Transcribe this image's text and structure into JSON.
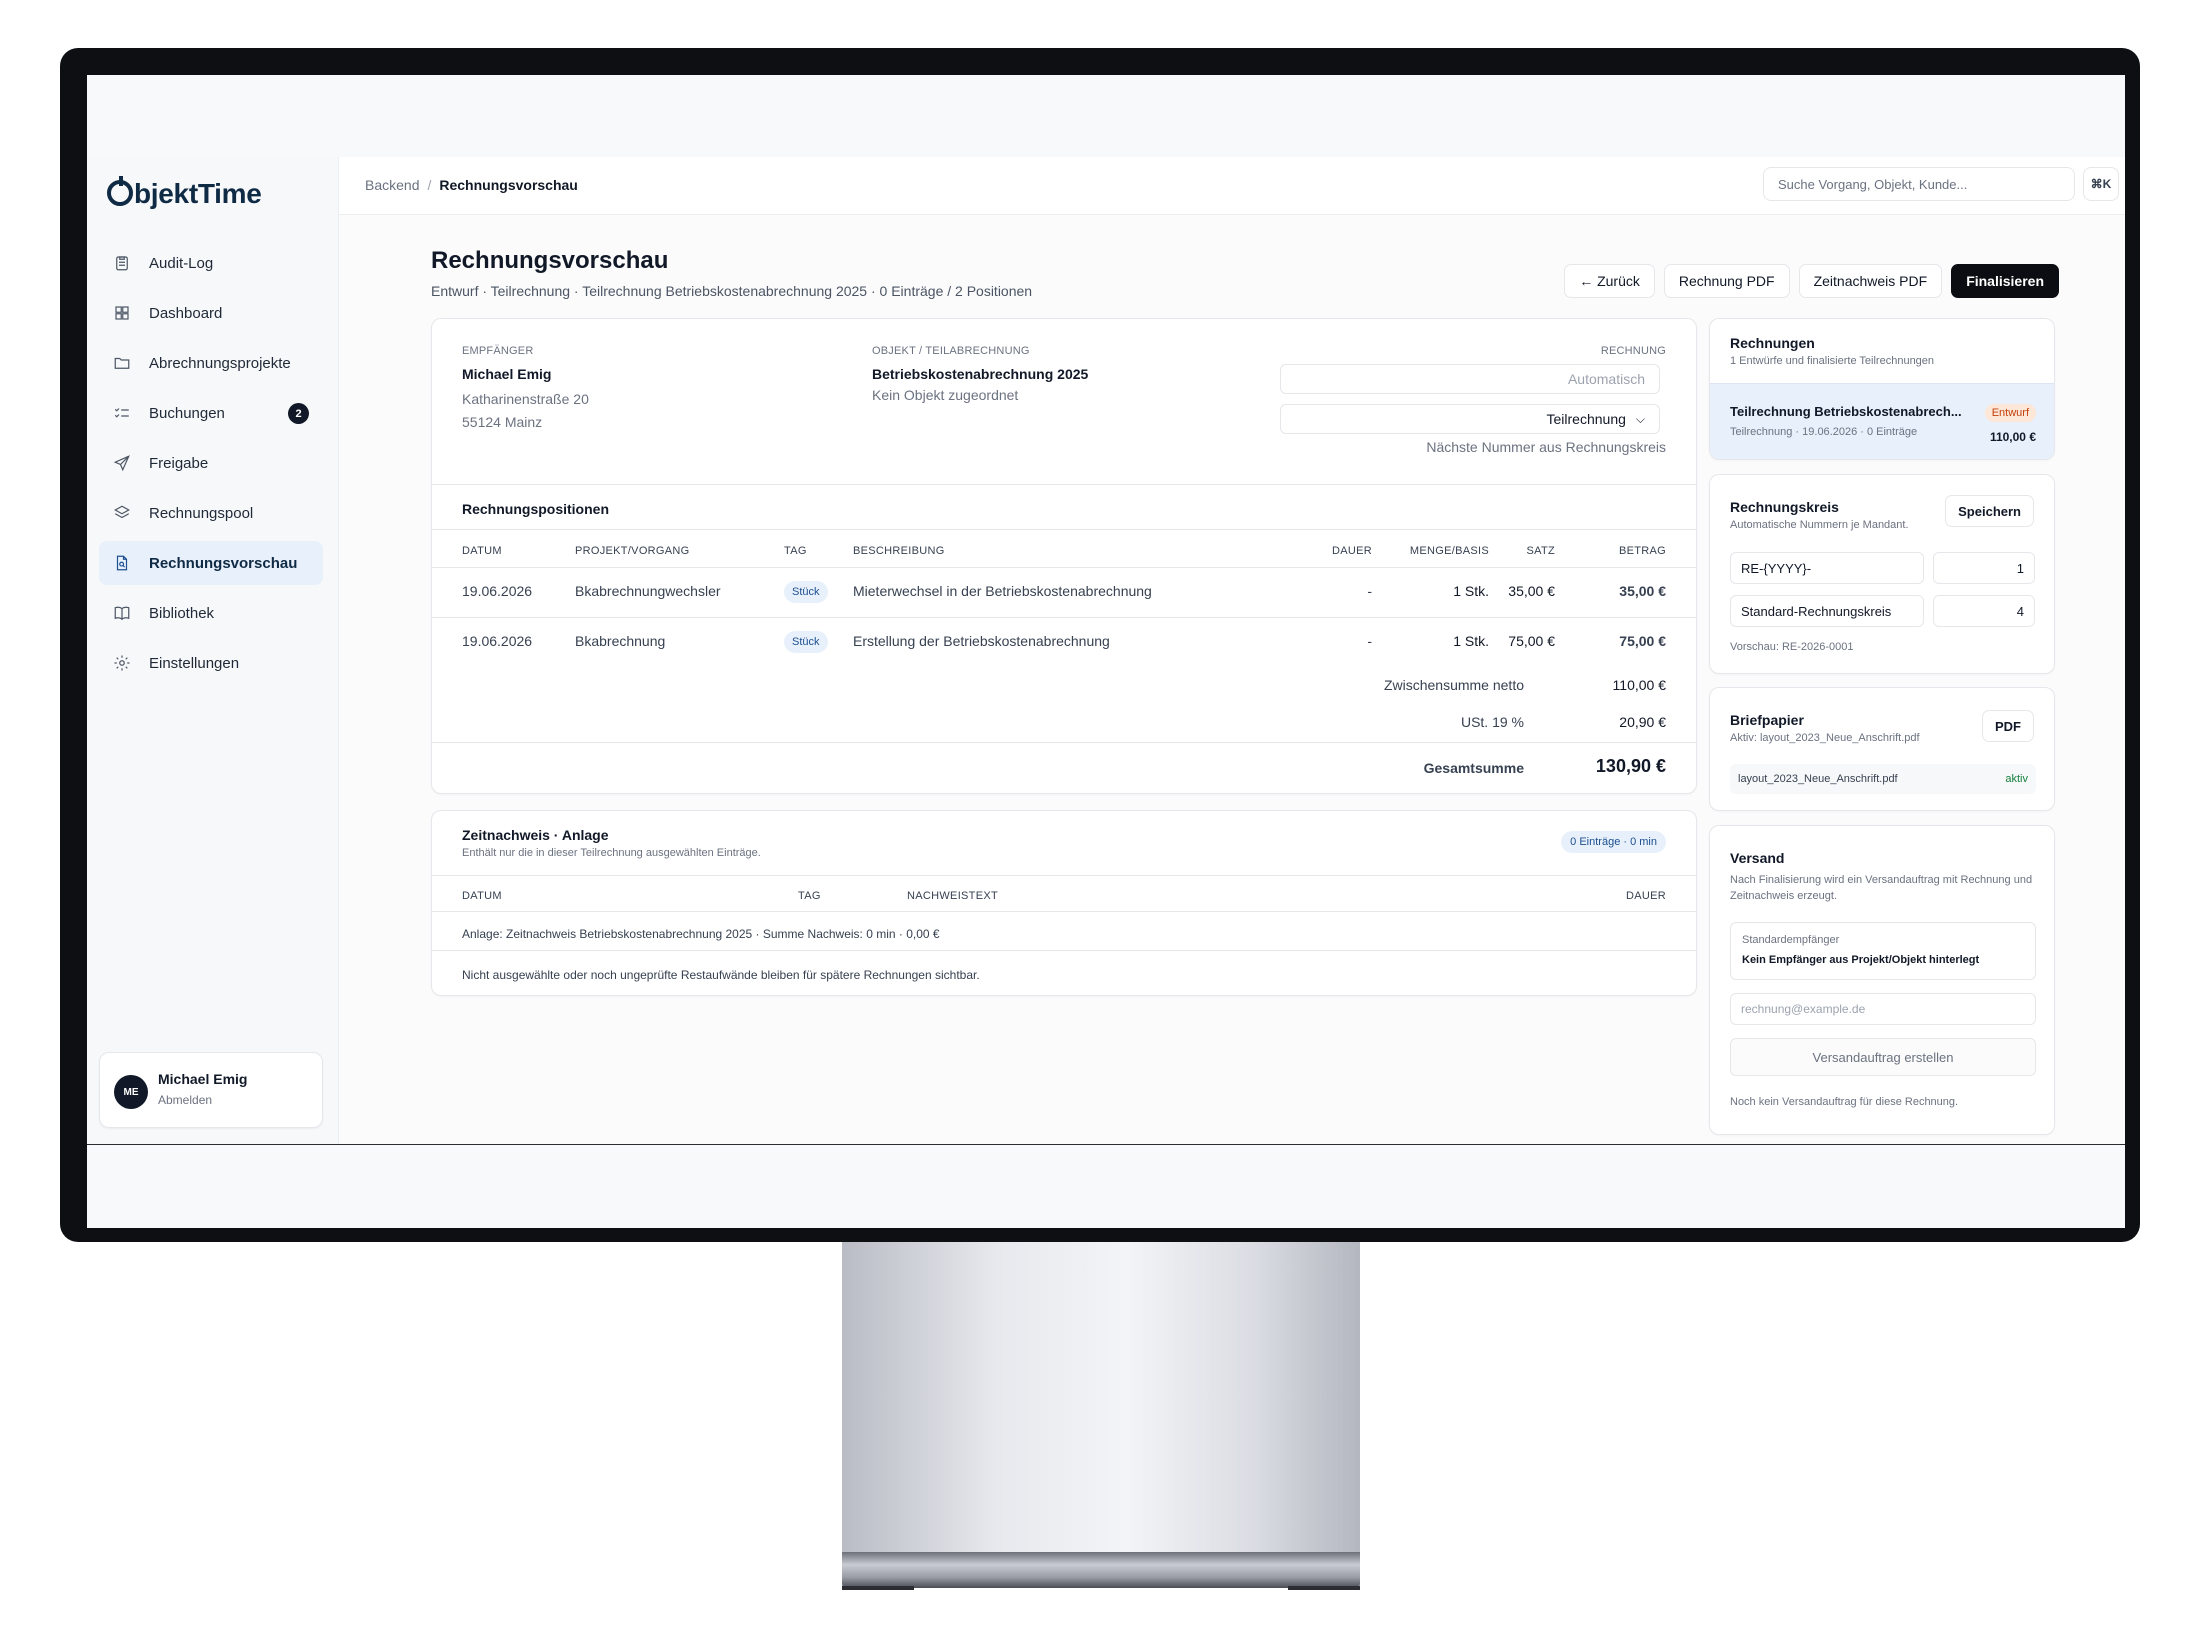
{
  "brand": {
    "name_rest": "bjektTime"
  },
  "sidebar": {
    "items": [
      {
        "label": "Audit-Log"
      },
      {
        "label": "Dashboard"
      },
      {
        "label": "Abrechnungsprojekte"
      },
      {
        "label": "Buchungen",
        "badge": "2"
      },
      {
        "label": "Freigabe"
      },
      {
        "label": "Rechnungspool"
      },
      {
        "label": "Rechnungsvorschau"
      },
      {
        "label": "Bibliothek"
      },
      {
        "label": "Einstellungen"
      }
    ],
    "user": {
      "initials": "ME",
      "name": "Michael Emig",
      "logout": "Abmelden"
    }
  },
  "topbar": {
    "breadcrumb_root": "Backend",
    "breadcrumb_sep": "/",
    "breadcrumb_current": "Rechnungsvorschau",
    "search_placeholder": "Suche Vorgang, Objekt, Kunde...",
    "shortcut": "⌘K"
  },
  "page": {
    "title": "Rechnungsvorschau",
    "subtitle": "Entwurf · Teilrechnung · Teilrechnung Betriebskostenabrechnung 2025 · 0 Einträge / 2 Positionen",
    "actions": {
      "back": "← Zurück",
      "invoice_pdf": "Rechnung PDF",
      "timesheet_pdf": "Zeitnachweis PDF",
      "finalize": "Finalisieren"
    }
  },
  "invoice": {
    "recipient_label": "EMPFÄNGER",
    "recipient_name": "Michael Emig",
    "recipient_street": "Katharinenstraße 20",
    "recipient_city": "55124 Mainz",
    "object_label": "OBJEKT / TEILABRECHNUNG",
    "object_name": "Betriebskostenabrechnung 2025",
    "object_note": "Kein Objekt zugeordnet",
    "invoice_label": "RECHNUNG",
    "number_placeholder": "Automatisch",
    "type_value": "Teilrechnung",
    "number_hint": "Nächste Nummer aus Rechnungskreis",
    "positions_title": "Rechnungspositionen",
    "columns": {
      "date": "DATUM",
      "project": "PROJEKT/VORGANG",
      "tag": "TAG",
      "description": "BESCHREIBUNG",
      "duration": "DAUER",
      "quantity": "MENGE/BASIS",
      "rate": "SATZ",
      "amount": "BETRAG"
    },
    "rows": [
      {
        "date": "19.06.2026",
        "project": "Bkabrechnungwechsler",
        "tag": "Stück",
        "description": "Mieterwechsel in der Betriebskostenabrechnung",
        "duration": "-",
        "quantity": "1 Stk.",
        "rate": "35,00 €",
        "amount": "35,00 €"
      },
      {
        "date": "19.06.2026",
        "project": "Bkabrechnung",
        "tag": "Stück",
        "description": "Erstellung der Betriebskostenabrechnung",
        "duration": "-",
        "quantity": "1 Stk.",
        "rate": "75,00 €",
        "amount": "75,00 €"
      }
    ],
    "subtotal_label": "Zwischensumme netto",
    "subtotal_value": "110,00 €",
    "vat_label": "USt. 19 %",
    "vat_value": "20,90 €",
    "total_label": "Gesamtsumme",
    "total_value": "130,90 €"
  },
  "timesheet": {
    "title": "Zeitnachweis · Anlage",
    "subtitle": "Enthält nur die in dieser Teilrechnung ausgewählten Einträge.",
    "badge": "0 Einträge · 0 min",
    "columns": {
      "date": "DATUM",
      "tag": "TAG",
      "text": "NACHWEISTEXT",
      "duration": "DAUER"
    },
    "summary": "Anlage: Zeitnachweis Betriebskostenabrechnung 2025 · Summe Nachweis: 0 min · 0,00 €",
    "note": "Nicht ausgewählte oder noch ungeprüfte Restaufwände bleiben für spätere Rechnungen sichtbar."
  },
  "invoices_panel": {
    "title": "Rechnungen",
    "subtitle": "1 Entwürfe und finalisierte Teilrechnungen",
    "item_title": "Teilrechnung Betriebskostenabrech...",
    "item_status": "Entwurf",
    "item_meta": "Teilrechnung · 19.06.2026 · 0 Einträge",
    "item_amount": "110,00 €"
  },
  "number_circle": {
    "title": "Rechnungskreis",
    "subtitle": "Automatische Nummern je Mandant.",
    "save": "Speichern",
    "prefix": "RE-{YYYY}-",
    "next": "1",
    "name": "Standard-Rechnungskreis",
    "digits": "4",
    "preview": "Vorschau: RE-2026-0001"
  },
  "letterhead": {
    "title": "Briefpapier",
    "subtitle": "Aktiv: layout_2023_Neue_Anschrift.pdf",
    "pdf": "PDF",
    "file": "layout_2023_Neue_Anschrift.pdf",
    "status": "aktiv"
  },
  "shipping": {
    "title": "Versand",
    "subtitle": "Nach Finalisierung wird ein Versandauftrag mit Rechnung und Zeitnachweis erzeugt.",
    "default_label": "Standardempfänger",
    "default_value": "Kein Empfänger aus Projekt/Objekt hinterlegt",
    "email_placeholder": "rechnung@example.de",
    "create": "Versandauftrag erstellen",
    "note": "Noch kein Versandauftrag für diese Rechnung."
  },
  "colors": {
    "accent_dark": "#0b0d12",
    "brand": "#0f2a44",
    "tag_bg": "#e8f1fb",
    "draft": "#c2410c",
    "active": "#15803d"
  }
}
